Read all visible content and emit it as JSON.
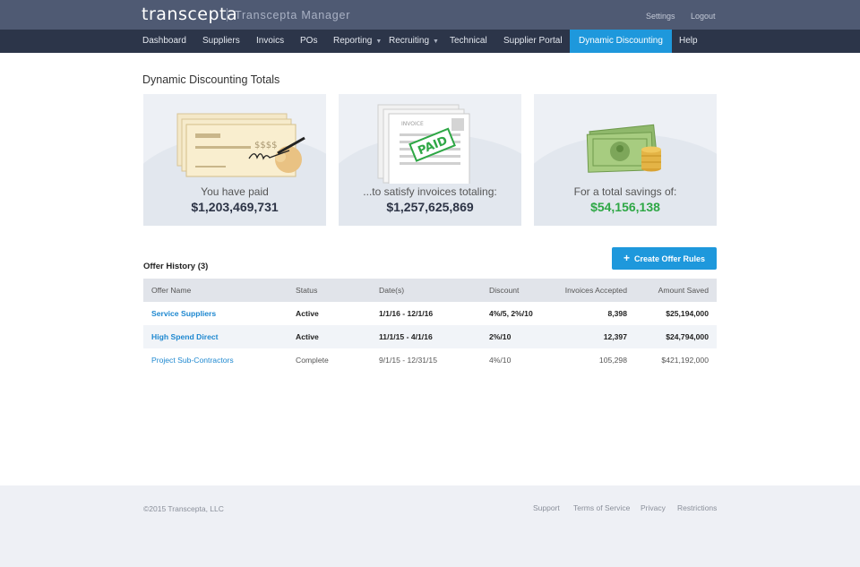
{
  "header": {
    "logo_text": "transcepta",
    "app_name": "Transcepta Manager",
    "links": {
      "settings": "Settings",
      "logout": "Logout"
    }
  },
  "nav": {
    "items": [
      {
        "label": "Dashboard"
      },
      {
        "label": "Suppliers"
      },
      {
        "label": "Invoics"
      },
      {
        "label": "POs"
      },
      {
        "label": "Reporting",
        "dropdown": true
      },
      {
        "label": "Recruiting",
        "dropdown": true
      },
      {
        "label": "Technical"
      },
      {
        "label": "Supplier Portal"
      },
      {
        "label": "Dynamic Discounting",
        "active": true
      },
      {
        "label": "Help"
      }
    ]
  },
  "page": {
    "title": "Dynamic Discounting Totals"
  },
  "cards": [
    {
      "label": "You have paid",
      "value": "$1,203,469,731",
      "illustration": "check-illustration",
      "check_text": "$$$$"
    },
    {
      "label": "...to satisfy invoices totaling:",
      "value": "$1,257,625,869",
      "illustration": "invoice-illustration",
      "doc_title": "INVOICE",
      "stamp": "PAID"
    },
    {
      "label": "For a total savings of:",
      "value": "$54,156,138",
      "illustration": "money-illustration",
      "value_color": "#2ea745"
    }
  ],
  "offers": {
    "heading": "Offer History (3)",
    "create_button": "Create Offer Rules",
    "columns": [
      "Offer Name",
      "Status",
      "Date(s)",
      "Discount",
      "Invoices Accepted",
      "Amount Saved"
    ],
    "rows": [
      {
        "name": "Service Suppliers",
        "status": "Active",
        "dates": "1/1/16 - 12/1/16",
        "discount": "4%/5, 2%/10",
        "invoices": "8,398",
        "saved": "$25,194,000"
      },
      {
        "name": "High Spend Direct",
        "status": "Active",
        "dates": "11/1/15 - 4/1/16",
        "discount": "2%/10",
        "invoices": "12,397",
        "saved": "$24,794,000"
      },
      {
        "name": "Project Sub-Contractors",
        "status": "Complete",
        "dates": "9/1/15 - 12/31/15",
        "discount": "4%/10",
        "invoices": "105,298",
        "saved": "$421,192,000"
      }
    ]
  },
  "footer": {
    "copyright": "©2015 Transcepta, LLC",
    "links": [
      "Support",
      "Terms of Service",
      "Privacy",
      "Restrictions"
    ]
  },
  "colors": {
    "accent": "#1e98dc",
    "topbar": "#4f5a73",
    "navbar": "#2c3549",
    "savings": "#2ea745"
  }
}
